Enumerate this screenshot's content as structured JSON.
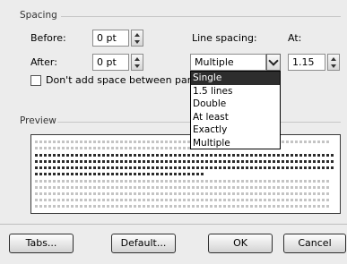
{
  "spacing": {
    "title": "Spacing",
    "before_label": "Before:",
    "before_value": "0 pt",
    "after_label": "After:",
    "after_value": "0 pt",
    "line_spacing_label": "Line spacing:",
    "line_spacing_value": "Multiple",
    "at_label": "At:",
    "at_value": "1.15",
    "dont_add_space_label": "Don't add space between paragra"
  },
  "line_spacing_options": [
    "Single",
    "1.5 lines",
    "Double",
    "At least",
    "Exactly",
    "Multiple"
  ],
  "preview": {
    "title": "Preview"
  },
  "buttons": {
    "tabs": "Tabs...",
    "default": "Default...",
    "ok": "OK",
    "cancel": "Cancel"
  },
  "colors": {
    "highlight": "#2d2d2d",
    "background": "#ececec"
  }
}
